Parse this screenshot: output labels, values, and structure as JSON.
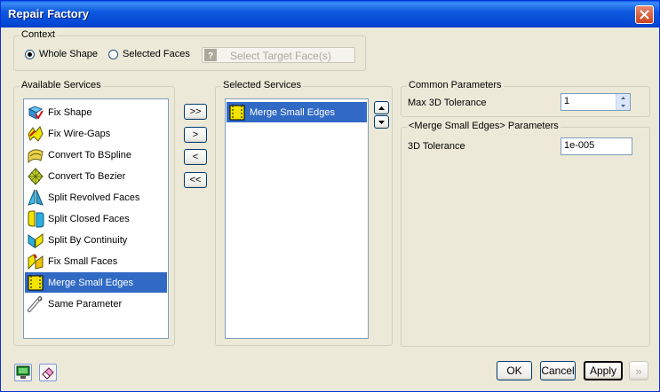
{
  "window": {
    "title": "Repair Factory"
  },
  "context": {
    "legend": "Context",
    "whole_shape_label": "Whole Shape",
    "selected_faces_label": "Selected Faces",
    "select_target_label": "Select Target Face(s)",
    "selected_option": "Whole Shape"
  },
  "available": {
    "legend": "Available Services",
    "items": [
      {
        "label": "Fix Shape",
        "icon": "fix-shape-icon"
      },
      {
        "label": "Fix Wire-Gaps",
        "icon": "fix-wire-gaps-icon"
      },
      {
        "label": "Convert To BSpline",
        "icon": "convert-bspline-icon"
      },
      {
        "label": "Convert To Bezier",
        "icon": "convert-bezier-icon"
      },
      {
        "label": "Split Revolved Faces",
        "icon": "split-revolved-icon"
      },
      {
        "label": "Split Closed Faces",
        "icon": "split-closed-icon"
      },
      {
        "label": "Split By Continuity",
        "icon": "split-continuity-icon"
      },
      {
        "label": "Fix Small Faces",
        "icon": "fix-small-faces-icon"
      },
      {
        "label": "Merge Small Edges",
        "icon": "merge-small-edges-icon"
      },
      {
        "label": "Same Parameter",
        "icon": "same-parameter-icon"
      }
    ],
    "selected_item": "Merge Small Edges"
  },
  "transfer": {
    "add_all": ">>",
    "add": ">",
    "remove": "<",
    "remove_all": "<<"
  },
  "selected": {
    "legend": "Selected Services",
    "items": [
      {
        "label": "Merge Small Edges",
        "icon": "merge-small-edges-icon"
      }
    ]
  },
  "common": {
    "legend": "Common Parameters",
    "max_tol_label": "Max 3D Tolerance",
    "max_tol_value": "1"
  },
  "params": {
    "legend": "<Merge Small Edges> Parameters",
    "tol_label": "3D Tolerance",
    "tol_value": "1e-005"
  },
  "footer": {
    "ok": "OK",
    "cancel": "Cancel",
    "apply": "Apply",
    "next": "»"
  },
  "colors": {
    "selection": "#316AC5",
    "title_bar": "#0A5FE8",
    "dialog_bg": "#ECE9D8"
  }
}
